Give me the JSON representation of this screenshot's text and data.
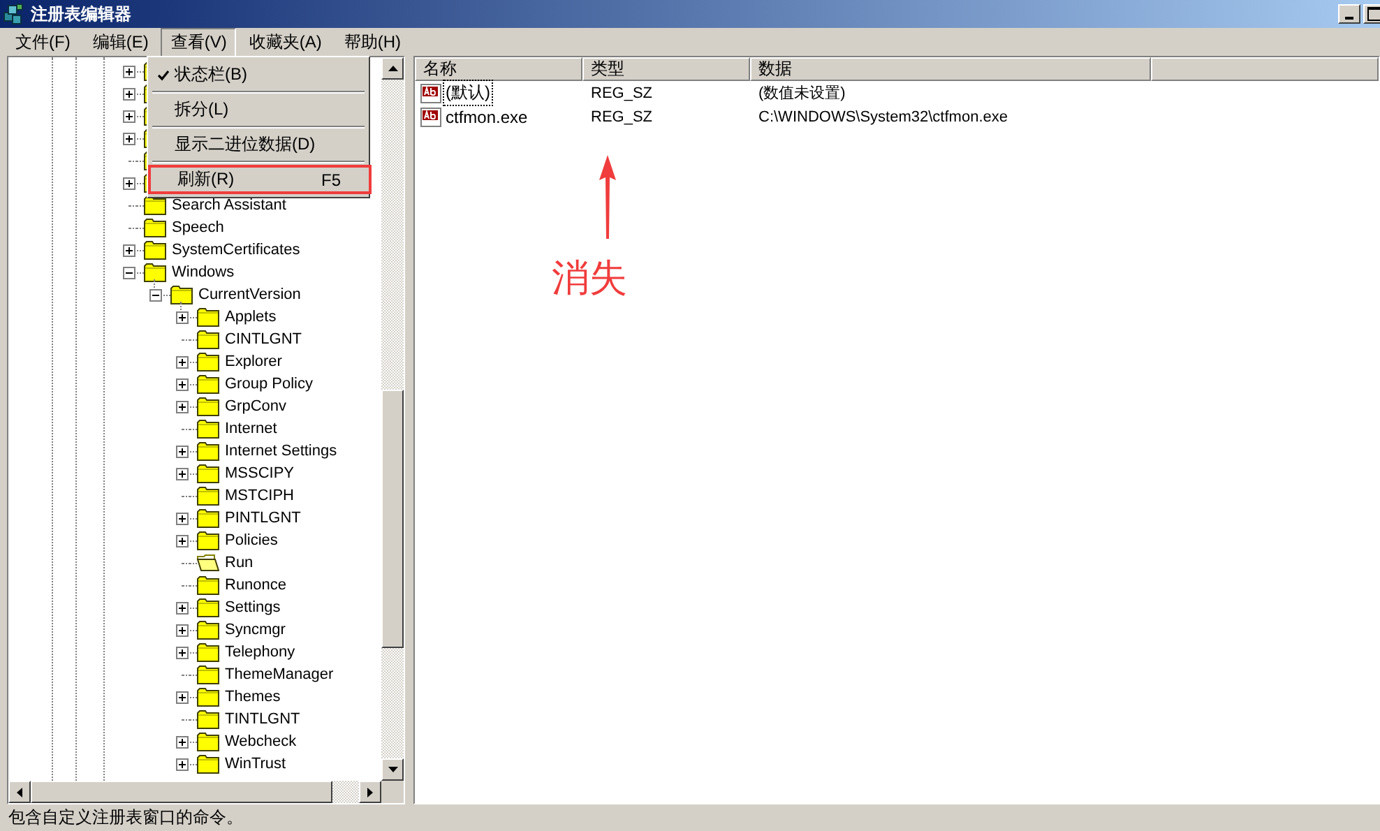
{
  "window": {
    "title": "注册表编辑器"
  },
  "menu_bar": [
    {
      "label": "文件(F)",
      "selected": false
    },
    {
      "label": "编辑(E)",
      "selected": false
    },
    {
      "label": "查看(V)",
      "selected": true
    },
    {
      "label": "收藏夹(A)",
      "selected": false
    },
    {
      "label": "帮助(H)",
      "selected": false
    }
  ],
  "view_menu": [
    {
      "kind": "item",
      "label": "状态栏(B)",
      "checked": true,
      "annotated": false
    },
    {
      "kind": "separator"
    },
    {
      "kind": "item",
      "label": "拆分(L)",
      "checked": false,
      "annotated": false
    },
    {
      "kind": "separator"
    },
    {
      "kind": "item",
      "label": "显示二进位数据(D)",
      "checked": false,
      "annotated": false
    },
    {
      "kind": "separator"
    },
    {
      "kind": "item",
      "label": "刷新(R)",
      "shortcut": "F5",
      "checked": false,
      "annotated": true
    }
  ],
  "tree": [
    {
      "expandable": true,
      "expanded": false,
      "selected": false
    },
    {
      "expandable": true,
      "expanded": false,
      "selected": false
    },
    {
      "expandable": true,
      "expanded": false,
      "selected": false
    },
    {
      "expandable": true,
      "expanded": false,
      "selected": false
    },
    {
      "expandable": false,
      "selected": false
    },
    {
      "expandable": true,
      "expanded": false,
      "selected": false
    },
    {
      "label": "Search Assistant",
      "expandable": false,
      "selected": false
    },
    {
      "label": "Speech",
      "expandable": false,
      "selected": false
    },
    {
      "label": "SystemCertificates",
      "expandable": true,
      "expanded": false,
      "selected": false
    },
    {
      "label": "Windows",
      "expandable": true,
      "expanded": true,
      "selected": false,
      "children": [
        {
          "label": "CurrentVersion",
          "expandable": true,
          "expanded": true,
          "selected": false,
          "children": [
            {
              "label": "Applets",
              "expandable": true,
              "expanded": false,
              "selected": false
            },
            {
              "label": "CINTLGNT",
              "expandable": false,
              "selected": false
            },
            {
              "label": "Explorer",
              "expandable": true,
              "expanded": false,
              "selected": false
            },
            {
              "label": "Group Policy",
              "expandable": true,
              "expanded": false,
              "selected": false
            },
            {
              "label": "GrpConv",
              "expandable": true,
              "expanded": false,
              "selected": false
            },
            {
              "label": "Internet",
              "expandable": false,
              "selected": false
            },
            {
              "label": "Internet Settings",
              "expandable": true,
              "expanded": false,
              "selected": false
            },
            {
              "label": "MSSCIPY",
              "expandable": true,
              "expanded": false,
              "selected": false
            },
            {
              "label": "MSTCIPH",
              "expandable": false,
              "selected": false
            },
            {
              "label": "PINTLGNT",
              "expandable": true,
              "expanded": false,
              "selected": false
            },
            {
              "label": "Policies",
              "expandable": true,
              "expanded": false,
              "selected": false
            },
            {
              "label": "Run",
              "expandable": false,
              "selected": true
            },
            {
              "label": "Runonce",
              "expandable": false,
              "selected": false
            },
            {
              "label": "Settings",
              "expandable": true,
              "expanded": false,
              "selected": false
            },
            {
              "label": "Syncmgr",
              "expandable": true,
              "expanded": false,
              "selected": false
            },
            {
              "label": "Telephony",
              "expandable": true,
              "expanded": false,
              "selected": false
            },
            {
              "label": "ThemeManager",
              "expandable": false,
              "selected": false
            },
            {
              "label": "Themes",
              "expandable": true,
              "expanded": false,
              "selected": false
            },
            {
              "label": "TINTLGNT",
              "expandable": false,
              "selected": false
            },
            {
              "label": "Webcheck",
              "expandable": true,
              "expanded": false,
              "selected": false
            },
            {
              "label": "WinTrust",
              "expandable": true,
              "expanded": false,
              "selected": false
            }
          ]
        }
      ]
    }
  ],
  "list": {
    "columns": [
      "名称",
      "类型",
      "数据"
    ],
    "rows": [
      {
        "name": "(默认)",
        "type": "REG_SZ",
        "data": "(数值未设置)",
        "focused": true
      },
      {
        "name": "ctfmon.exe",
        "type": "REG_SZ",
        "data": "C:\\WINDOWS\\System32\\ctfmon.exe",
        "focused": false
      }
    ]
  },
  "annotation": {
    "text": "消失"
  },
  "status_bar": "包含自定义注册表窗口的命令。"
}
